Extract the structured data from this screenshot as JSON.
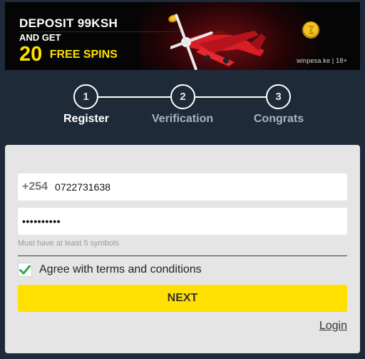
{
  "banner": {
    "deposit_text": "DEPOSIT 99KSH",
    "and_get_text": "AND GET",
    "spins_number": "20",
    "spins_text": "FREE SPINS",
    "site_tag": "winpesa.ke | 18+",
    "accent_color": "#ffe000"
  },
  "steps": [
    {
      "number": "1",
      "label": "Register",
      "state": "active"
    },
    {
      "number": "2",
      "label": "Verification",
      "state": "inactive"
    },
    {
      "number": "3",
      "label": "Congrats",
      "state": "inactive"
    }
  ],
  "form": {
    "phone_prefix": "+254",
    "phone_value": "0722731638",
    "password_masked": "••••••••••",
    "password_hint": "Must have at least 5 symbols",
    "agree_label": "Agree with terms and conditions",
    "agree_checked": true,
    "next_label": "NEXT",
    "login_label": "Login"
  },
  "icons": {
    "plane": "red-plane-icon",
    "coin": "gold-coin-icon",
    "check": "checkmark-icon"
  },
  "colors": {
    "background": "#1e2a38",
    "panel": "#e5e5e5",
    "button": "#ffe000",
    "check": "#2ea84a"
  }
}
